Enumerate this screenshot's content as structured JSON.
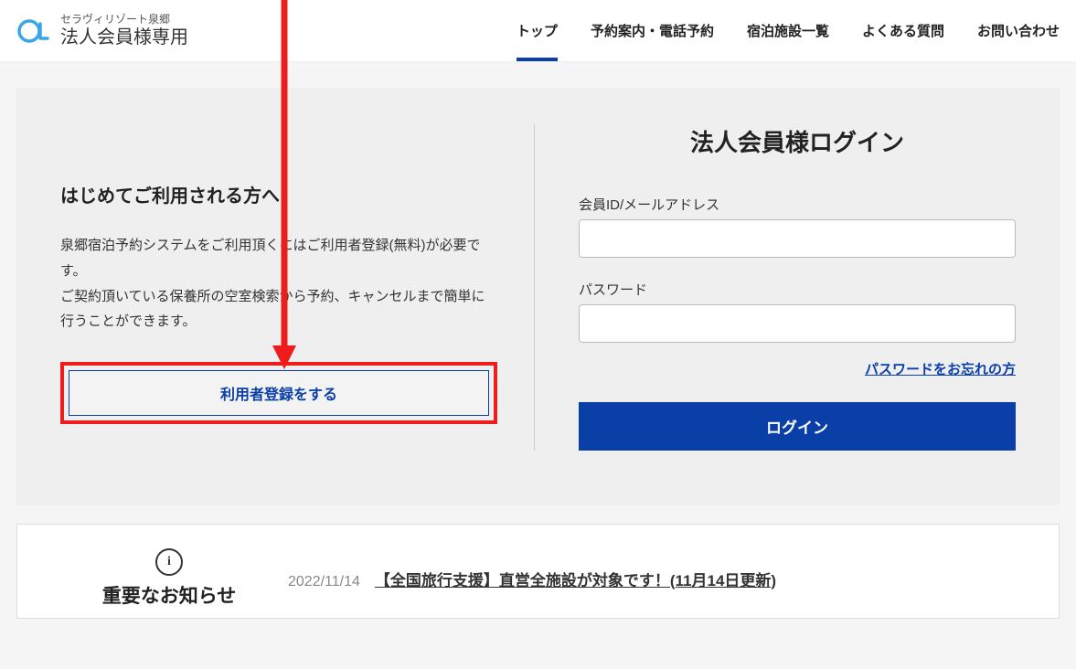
{
  "header": {
    "logo_sub": "セラヴィリゾート泉郷",
    "logo_main": "法人会員様専用",
    "nav": [
      {
        "label": "トップ",
        "active": true
      },
      {
        "label": "予約案内・電話予約",
        "active": false
      },
      {
        "label": "宿泊施設一覧",
        "active": false
      },
      {
        "label": "よくある質問",
        "active": false
      },
      {
        "label": "お問い合わせ",
        "active": false
      }
    ]
  },
  "firstTime": {
    "title": "はじめてご利用される方へ",
    "desc": "泉郷宿泊予約システムをご利用頂くにはご利用者登録(無料)が必要です。\nご契約頂いている保養所の空室検索から予約、キャンセルまで簡単に行うことができます。",
    "register_label": "利用者登録をする"
  },
  "login": {
    "title": "法人会員様ログイン",
    "id_label": "会員ID/メールアドレス",
    "pw_label": "パスワード",
    "forgot_label": "パスワードをお忘れの方",
    "login_label": "ログイン"
  },
  "news": {
    "icon_glyph": "i",
    "heading": "重要なお知らせ",
    "date": "2022/11/14",
    "link_text": "【全国旅行支援】直営全施設が対象です！(11月14日更新)"
  },
  "colors": {
    "primary": "#0a3fa8",
    "highlight_border": "#ee1c1c"
  }
}
